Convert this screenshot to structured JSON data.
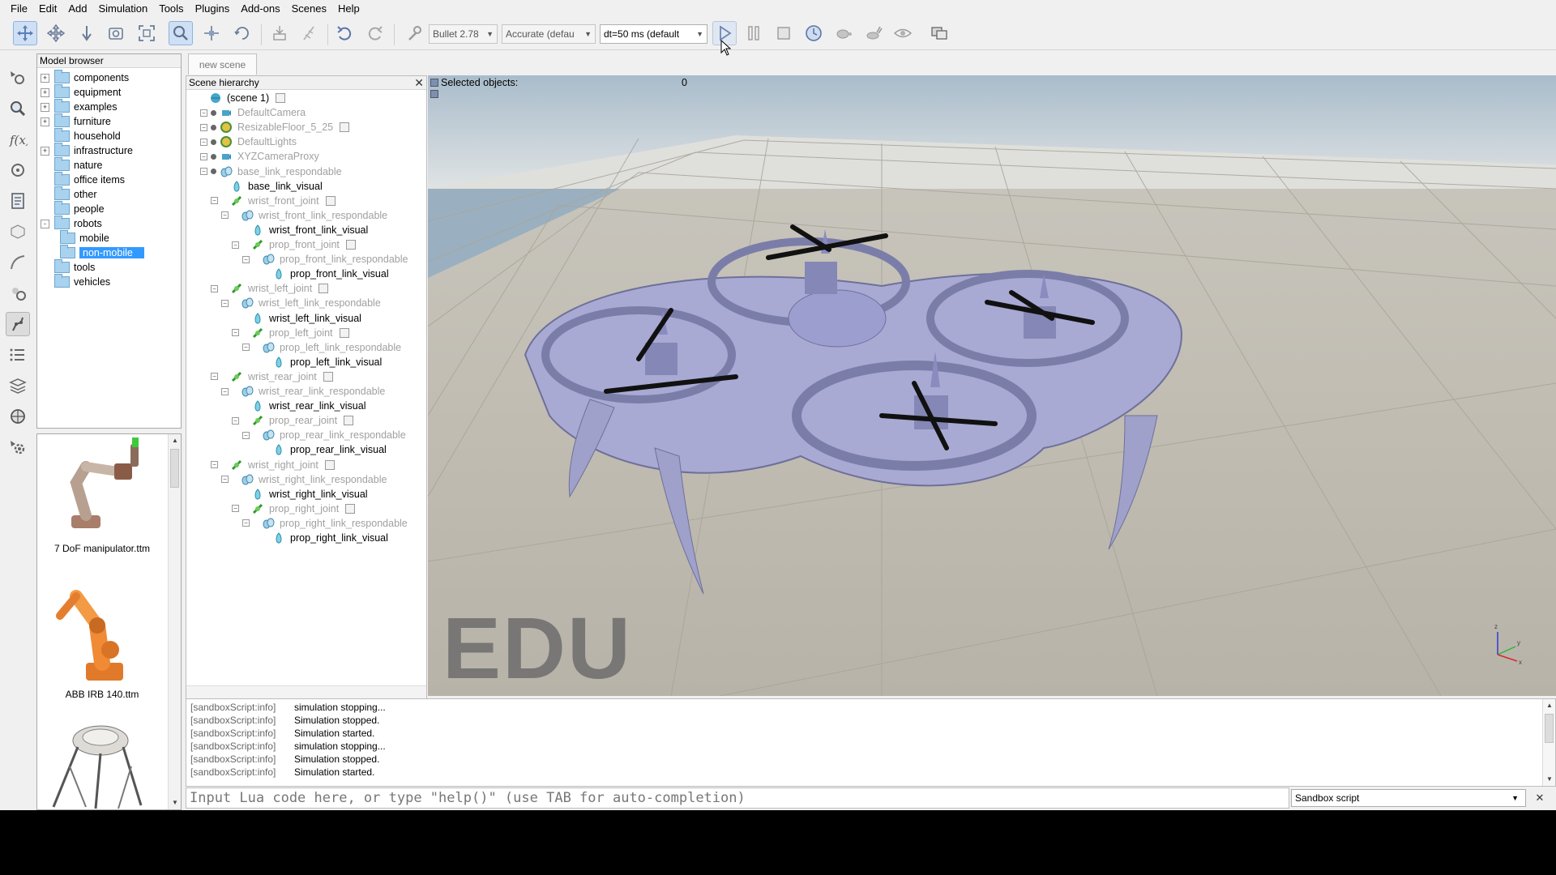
{
  "menu": [
    "File",
    "Edit",
    "Add",
    "Simulation",
    "Tools",
    "Plugins",
    "Add-ons",
    "Scenes",
    "Help"
  ],
  "toolbar": {
    "engine": "Bullet 2.78",
    "accuracy": "Accurate (defau",
    "timestep": "dt=50 ms (default"
  },
  "model_browser": {
    "title": "Model browser",
    "items": [
      {
        "label": "components",
        "expander": "+"
      },
      {
        "label": "equipment",
        "expander": "+"
      },
      {
        "label": "examples",
        "expander": "+"
      },
      {
        "label": "furniture",
        "expander": "+"
      },
      {
        "label": "household",
        "expander": ""
      },
      {
        "label": "infrastructure",
        "expander": "+"
      },
      {
        "label": "nature",
        "expander": ""
      },
      {
        "label": "office items",
        "expander": ""
      },
      {
        "label": "other",
        "expander": ""
      },
      {
        "label": "people",
        "expander": ""
      },
      {
        "label": "robots",
        "expander": "-"
      },
      {
        "label": "mobile",
        "expander": "",
        "child": true
      },
      {
        "label": "non-mobile",
        "expander": "",
        "child": true,
        "selected": true
      },
      {
        "label": "tools",
        "expander": ""
      },
      {
        "label": "vehicles",
        "expander": ""
      }
    ]
  },
  "thumbnails": [
    {
      "caption": "7 DoF manipulator.ttm"
    },
    {
      "caption": "ABB IRB 140.ttm"
    },
    {
      "caption": ""
    }
  ],
  "scene_tab": "new scene",
  "hierarchy": {
    "title": "Scene hierarchy",
    "rows": [
      {
        "label": "(scene 1)",
        "indent": 0,
        "dim": false
      },
      {
        "label": "DefaultCamera",
        "indent": 1,
        "dim": true
      },
      {
        "label": "ResizableFloor_5_25",
        "indent": 1,
        "dim": true
      },
      {
        "label": "DefaultLights",
        "indent": 1,
        "dim": true
      },
      {
        "label": "XYZCameraProxy",
        "indent": 1,
        "dim": true
      },
      {
        "label": "base_link_respondable",
        "indent": 1,
        "dim": true
      },
      {
        "label": "base_link_visual",
        "indent": 2,
        "dim": false
      },
      {
        "label": "wrist_front_joint",
        "indent": 2,
        "dim": true
      },
      {
        "label": "wrist_front_link_respondable",
        "indent": 3,
        "dim": true
      },
      {
        "label": "wrist_front_link_visual",
        "indent": 4,
        "dim": false
      },
      {
        "label": "prop_front_joint",
        "indent": 4,
        "dim": true
      },
      {
        "label": "prop_front_link_respondable",
        "indent": 5,
        "dim": true
      },
      {
        "label": "prop_front_link_visual",
        "indent": 6,
        "dim": false
      },
      {
        "label": "wrist_left_joint",
        "indent": 2,
        "dim": true
      },
      {
        "label": "wrist_left_link_respondable",
        "indent": 3,
        "dim": true
      },
      {
        "label": "wrist_left_link_visual",
        "indent": 4,
        "dim": false
      },
      {
        "label": "prop_left_joint",
        "indent": 4,
        "dim": true
      },
      {
        "label": "prop_left_link_respondable",
        "indent": 5,
        "dim": true
      },
      {
        "label": "prop_left_link_visual",
        "indent": 6,
        "dim": false
      },
      {
        "label": "wrist_rear_joint",
        "indent": 2,
        "dim": true
      },
      {
        "label": "wrist_rear_link_respondable",
        "indent": 3,
        "dim": true
      },
      {
        "label": "wrist_rear_link_visual",
        "indent": 4,
        "dim": false
      },
      {
        "label": "prop_rear_joint",
        "indent": 4,
        "dim": true
      },
      {
        "label": "prop_rear_link_respondable",
        "indent": 5,
        "dim": true
      },
      {
        "label": "prop_rear_link_visual",
        "indent": 6,
        "dim": false
      },
      {
        "label": "wrist_right_joint",
        "indent": 2,
        "dim": true
      },
      {
        "label": "wrist_right_link_respondable",
        "indent": 3,
        "dim": true
      },
      {
        "label": "wrist_right_link_visual",
        "indent": 4,
        "dim": false
      },
      {
        "label": "prop_right_joint",
        "indent": 4,
        "dim": true
      },
      {
        "label": "prop_right_link_respondable",
        "indent": 5,
        "dim": true
      },
      {
        "label": "prop_right_link_visual",
        "indent": 6,
        "dim": false
      }
    ]
  },
  "viewport": {
    "selected_label": "Selected objects:",
    "selected_count": "0",
    "watermark": "EDU"
  },
  "console": {
    "lines": [
      {
        "prefix": "[sandboxScript:info]",
        "msg": "simulation stopping..."
      },
      {
        "prefix": "[sandboxScript:info]",
        "msg": "Simulation stopped."
      },
      {
        "prefix": "[sandboxScript:info]",
        "msg": "Simulation started."
      },
      {
        "prefix": "[sandboxScript:info]",
        "msg": "simulation stopping..."
      },
      {
        "prefix": "[sandboxScript:info]",
        "msg": "Simulation stopped."
      },
      {
        "prefix": "[sandboxScript:info]",
        "msg": "Simulation started."
      }
    ],
    "input_placeholder": "Input Lua code here, or type \"help()\" (use TAB for auto-completion)",
    "script_select": "Sandbox script"
  },
  "colors": {
    "selection": "#3399ff",
    "robot_body": "#a9abd6",
    "propeller": "#111111"
  }
}
